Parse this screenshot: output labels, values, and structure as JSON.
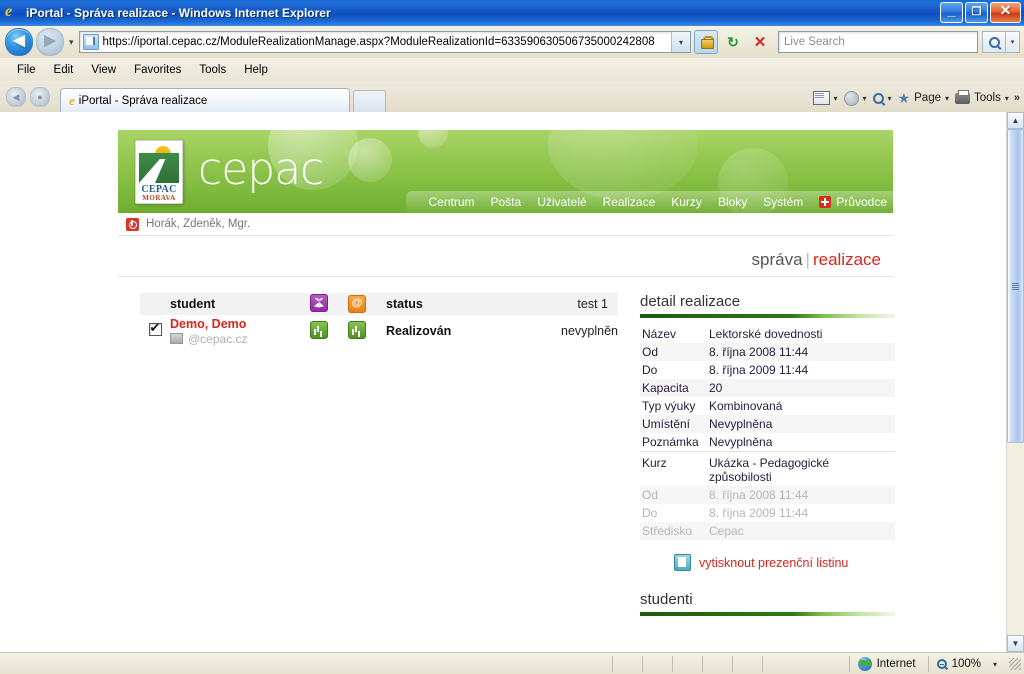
{
  "window": {
    "title": "iPortal - Správa realizace - Windows Internet Explorer",
    "minimize": "_",
    "maximize": "❐",
    "close": "✕"
  },
  "address": {
    "url": "https://iportal.cepac.cz/ModuleRealizationManage.aspx?ModuleRealizationId=6335906305067350002428​08",
    "url_display": "https://iportal.cepac.cz/ModuleRealizationManage.aspx?ModuleRealizationId=633590630506735000242808",
    "back_arrow": "◀",
    "forward_arrow": "▶",
    "history_chevron": "▾",
    "dropdown_chevron": "▾",
    "refresh_glyph": "↻",
    "stop_glyph": "✕"
  },
  "search": {
    "placeholder": "Live Search",
    "dropdown_chevron": "▾"
  },
  "menubar": {
    "items": [
      "File",
      "Edit",
      "View",
      "Favorites",
      "Tools",
      "Help"
    ]
  },
  "tabs": {
    "back_glyph": "◀",
    "recent_glyph": "●",
    "active_tab_label": "iPortal - Správa realizace",
    "commands": [
      {
        "icon": "mail-icon",
        "label": "",
        "chevron": "▾"
      },
      {
        "icon": "globe-icon",
        "label": "",
        "chevron": "▾"
      },
      {
        "icon": "search-icon",
        "label": "",
        "chevron": "▾"
      },
      {
        "icon": "star-icon",
        "label": "Page",
        "chevron": "▾"
      },
      {
        "icon": "printer-icon",
        "label": "Tools",
        "chevron": "▾"
      }
    ],
    "overflow_glyph": "»"
  },
  "brand": {
    "logo_name": "CEPAC",
    "logo_sub": "MORAVA",
    "wordmark": "cepac"
  },
  "nav": {
    "items": [
      "Centrum",
      "Pošta",
      "Uživatelé",
      "Realizace",
      "Kurzy",
      "Bloky",
      "Systém"
    ],
    "wizard": "Průvodce"
  },
  "user": {
    "name": "Horák, Zdeněk, Mgr."
  },
  "breadcrumb": {
    "primary": "správa",
    "separator": "|",
    "secondary": "realizace"
  },
  "students_table": {
    "headers": {
      "student": "student",
      "book_icon": "book-icon",
      "at_icon": "at-icon",
      "status": "status",
      "test": "test 1"
    },
    "rows": [
      {
        "checked": true,
        "check_glyph": "✔",
        "name": "Demo, Demo",
        "email": "@cepac.cz",
        "icon1": "chart-icon",
        "icon2": "chart-icon",
        "status": "Realizován",
        "test": "nevyplněn"
      }
    ]
  },
  "detail": {
    "heading": "detail realizace",
    "rows": [
      {
        "key": "Název",
        "value": "Lektorské dovednosti",
        "dim": false
      },
      {
        "key": "Od",
        "value": "8. října 2008 11:44",
        "dim": false
      },
      {
        "key": "Do",
        "value": "8. října 2009 11:44",
        "dim": false
      },
      {
        "key": "Kapacita",
        "value": "20",
        "dim": false
      },
      {
        "key": "Typ výuky",
        "value": "Kombinovaná",
        "dim": false
      },
      {
        "key": "Umístění",
        "value": "Nevyplněna",
        "dim": false
      },
      {
        "key": "Poznámka",
        "value": "Nevyplněna",
        "dim": false
      },
      {
        "key": "Kurz",
        "value": "Ukázka - Pedagogické způsobilosti",
        "dim": false
      },
      {
        "key": "Od",
        "value": "8. října 2008 11:44",
        "dim": true
      },
      {
        "key": "Do",
        "value": "8. října 2009 11:44",
        "dim": true
      },
      {
        "key": "Středisko",
        "value": "Cepac",
        "dim": true
      }
    ],
    "print_link": "vytisknout prezenční listinu",
    "students_heading": "studenti"
  },
  "statusbar": {
    "zone": "Internet",
    "zoom": "100%",
    "zoom_chevron": "▾"
  },
  "colors": {
    "accent_red": "#d9261c",
    "brand_green": "#7fbb3e",
    "title_blue": "#1358c6"
  }
}
